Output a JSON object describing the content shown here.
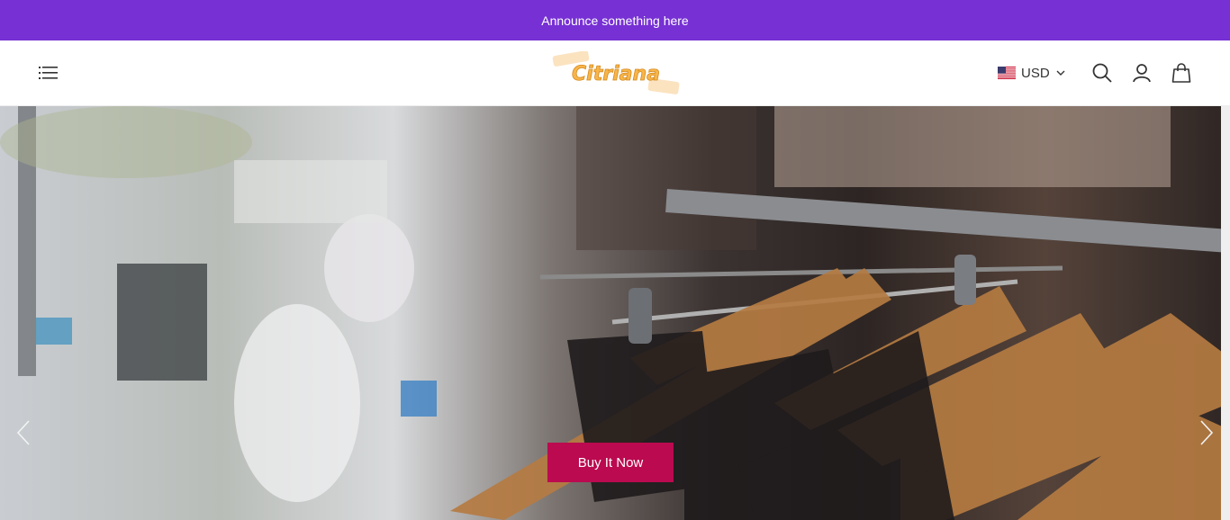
{
  "announcement": {
    "text": "Announce something here"
  },
  "header": {
    "logo_text": "Citriana",
    "currency": {
      "selected": "USD",
      "flag": "us-flag"
    },
    "icons": [
      "menu-icon",
      "search-icon",
      "account-icon",
      "cart-bag-icon",
      "chevron-down-icon"
    ]
  },
  "hero": {
    "cta_label": "Buy It Now",
    "nav": [
      "chevron-left-icon",
      "chevron-right-icon"
    ]
  },
  "colors": {
    "announcement_bg": "#7630d4",
    "cta_bg": "#bb0a4f",
    "logo": "#f7b54a"
  }
}
